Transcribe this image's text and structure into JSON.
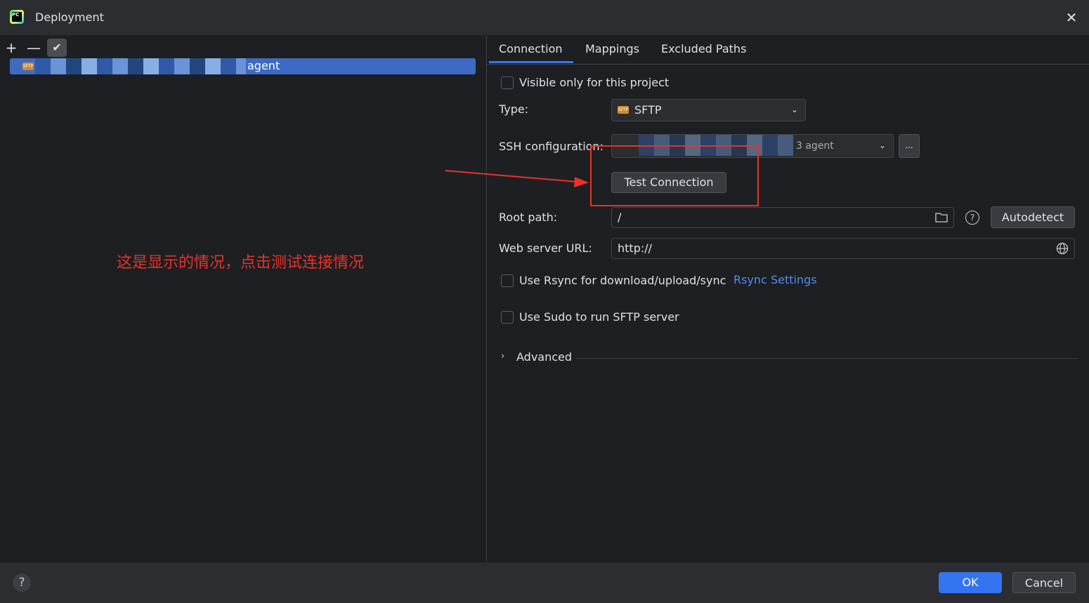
{
  "window": {
    "title": "Deployment"
  },
  "left": {
    "toolbar": {
      "add": "+",
      "remove": "—",
      "check": "✔"
    },
    "server": {
      "name": "agent",
      "type_badge": "SFTP"
    }
  },
  "annotation": {
    "text": "这是显示的情况，点击测试连接情况",
    "color": "#e8322a"
  },
  "tabs": [
    {
      "label": "Connection",
      "selected": true
    },
    {
      "label": "Mappings",
      "selected": false
    },
    {
      "label": "Excluded Paths",
      "selected": false
    }
  ],
  "form": {
    "visible_only": {
      "label": "Visible only for this project",
      "checked": false
    },
    "type": {
      "label": "Type:",
      "value": "SFTP"
    },
    "ssh": {
      "label": "SSH configuration:",
      "value_suffix": "3 agent",
      "more": "..."
    },
    "test_connection": "Test Connection",
    "root_path": {
      "label": "Root path:",
      "value": "/",
      "autodetect": "Autodetect",
      "help": "?"
    },
    "web_url": {
      "label": "Web server URL:",
      "value": "http://"
    },
    "rsync": {
      "label": "Use Rsync for download/upload/sync",
      "checked": false,
      "link": "Rsync Settings"
    },
    "sudo": {
      "label": "Use Sudo to run SFTP server",
      "checked": false
    },
    "advanced": "Advanced"
  },
  "footer": {
    "help": "?",
    "ok": "OK",
    "cancel": "Cancel"
  },
  "colors": {
    "accent": "#3574f0",
    "selection": "#3d6bc4",
    "link": "#548af7",
    "background": "#1e1f22"
  }
}
